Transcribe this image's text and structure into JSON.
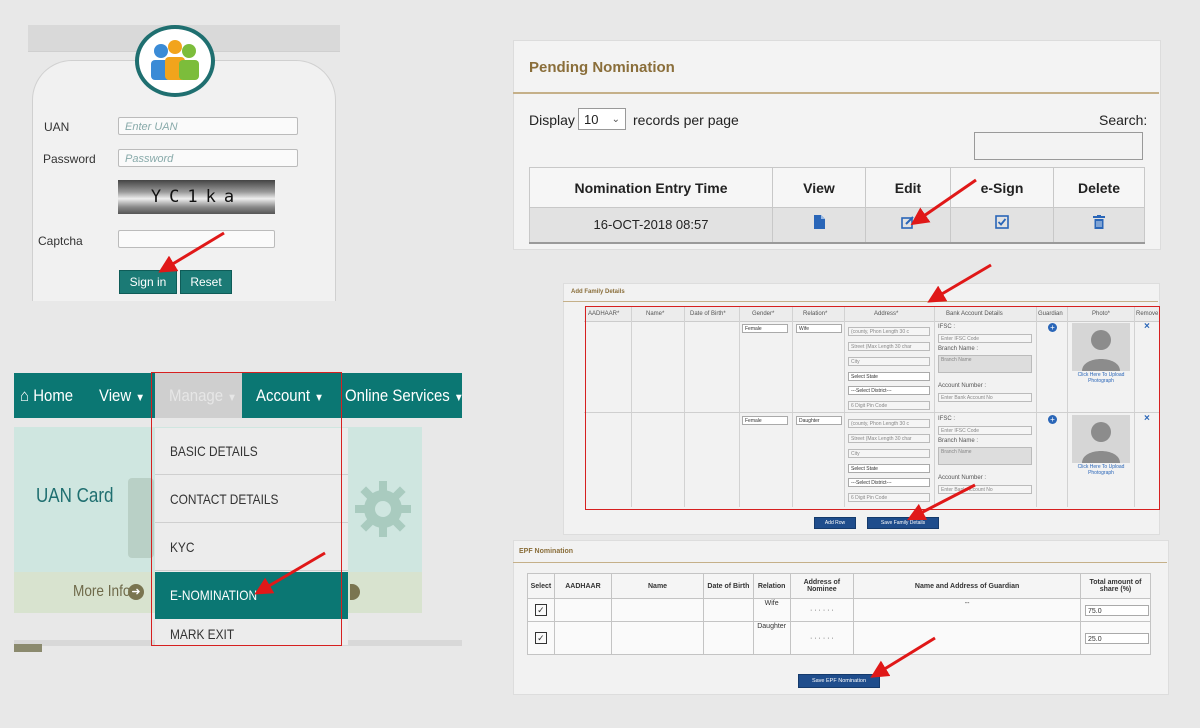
{
  "login": {
    "uan_label": "UAN",
    "uan_placeholder": "Enter UAN",
    "password_label": "Password",
    "password_placeholder": "Password",
    "captcha_text": "YC1ka",
    "captcha_label": "Captcha",
    "signin_label": "Sign in",
    "reset_label": "Reset"
  },
  "nav": {
    "home": "Home",
    "view": "View",
    "manage": "Manage",
    "account": "Account",
    "online_services": "Online Services"
  },
  "dashboard": {
    "uan_card": "UAN Card",
    "more_info": "More Info"
  },
  "manage_menu": {
    "items": [
      "BASIC DETAILS",
      "CONTACT DETAILS",
      "KYC",
      "E-NOMINATION",
      "MARK EXIT"
    ]
  },
  "pending": {
    "title": "Pending Nomination",
    "display_label": "Display",
    "display_value": "10",
    "records_label": "records per page",
    "search_label": "Search:",
    "headers": [
      "Nomination Entry Time",
      "View",
      "Edit",
      "e-Sign",
      "Delete"
    ],
    "row": {
      "entry_time": "16-OCT-2018 08:57"
    }
  },
  "family": {
    "title": "Add Family Details",
    "headers": [
      "AADHAAR*",
      "Name*",
      "Date of Birth*",
      "Gender*",
      "Relation*",
      "Address*",
      "Bank Account Details",
      "Guardian",
      "Photo*",
      "Remove"
    ],
    "rows": [
      {
        "gender": "Female",
        "relation": "Wife"
      },
      {
        "gender": "Female",
        "relation": "Daughter"
      }
    ],
    "address_placeholders": [
      "(county, Phon Length 30 c",
      "Street (Max Length 30 char",
      "City",
      "Select State",
      "---Select District---",
      "6 Digit Pin Code"
    ],
    "ifsc_label": "IFSC :",
    "ifsc_placeholder": "Enter IFSC Code",
    "branch_label": "Branch Name :",
    "branch_placeholder": "Branch Name",
    "account_label": "Account Number :",
    "account_placeholder": "Enter Bank Account No",
    "photo_link": "Click Here To Upload Photograph",
    "add_row": "Add Row",
    "save_family": "Save Family Details"
  },
  "epf": {
    "title": "EPF Nomination",
    "headers": [
      "Select",
      "AADHAAR",
      "Name",
      "Date of Birth",
      "Relation",
      "Address of Nominee",
      "Name and Address of Guardian",
      "Total amount of share (%)"
    ],
    "rows": [
      {
        "relation": "Wife",
        "address": "· · · · · ·",
        "guardian": "--",
        "share": "75.0"
      },
      {
        "relation": "Daughter",
        "address": "· · · · · ·",
        "guardian": "",
        "share": "25.0"
      }
    ],
    "save_label": "Save EPF Nomination"
  }
}
